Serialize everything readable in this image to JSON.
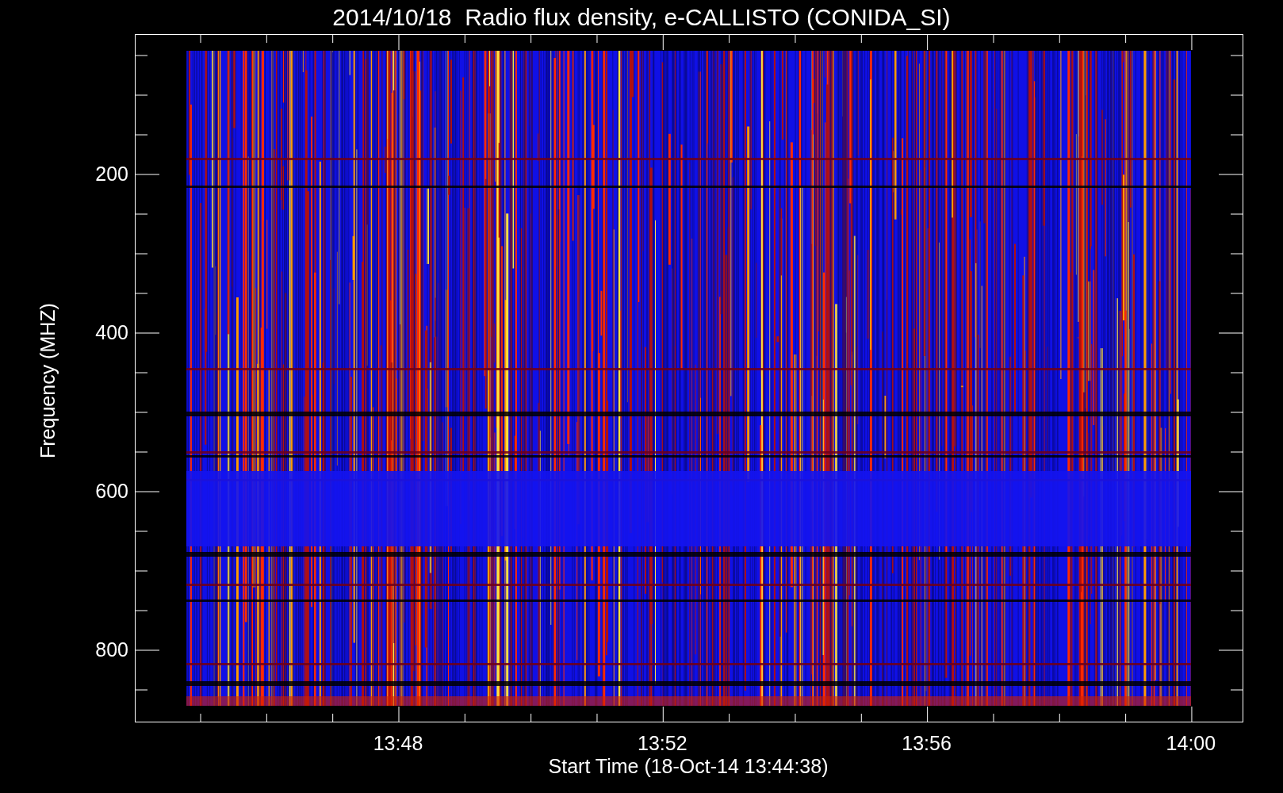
{
  "title": "2014/10/18  Radio flux density, e-CALLISTO (CONIDA_SI)",
  "y_axis": {
    "label": "Frequency (MHZ)",
    "ticks": [
      "200",
      "400",
      "600",
      "800"
    ]
  },
  "x_axis": {
    "label": "Start Time (18-Oct-14 13:44:38)",
    "ticks": [
      "13:48",
      "13:52",
      "13:56",
      "14:00"
    ]
  }
}
